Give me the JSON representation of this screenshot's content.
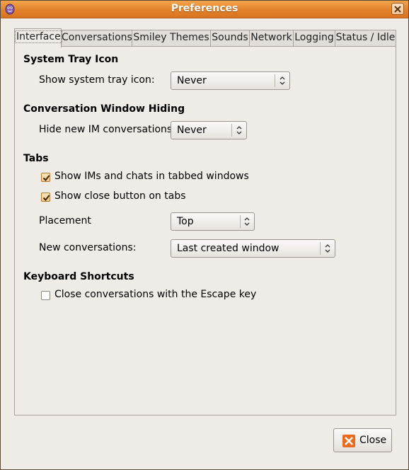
{
  "window": {
    "title": "Preferences"
  },
  "tabs": [
    "Interface",
    "Conversations",
    "Smiley Themes",
    "Sounds",
    "Network",
    "Logging",
    "Status / Idle"
  ],
  "active_tab": "Interface",
  "system_tray": {
    "heading": "System Tray Icon",
    "label": "Show system tray icon:",
    "value": "Never"
  },
  "conv_hiding": {
    "heading": "Conversation Window Hiding",
    "label": "Hide new IM conversations:",
    "value": "Never"
  },
  "tabs_section": {
    "heading": "Tabs",
    "check1_label": "Show IMs and chats in tabbed windows",
    "check1_checked": true,
    "check2_label": "Show close button on tabs",
    "check2_checked": true,
    "placement_label": "Placement",
    "placement_value": "Top",
    "newconv_label": "New conversations:",
    "newconv_value": "Last created window"
  },
  "shortcuts": {
    "heading": "Keyboard Shortcuts",
    "check_label": "Close conversations with the Escape key",
    "check_checked": false
  },
  "footer": {
    "close_label": "Close"
  },
  "colors": {
    "titlebar": "#e2822a",
    "background": "#efebe7",
    "accent": "#e96b1f"
  }
}
